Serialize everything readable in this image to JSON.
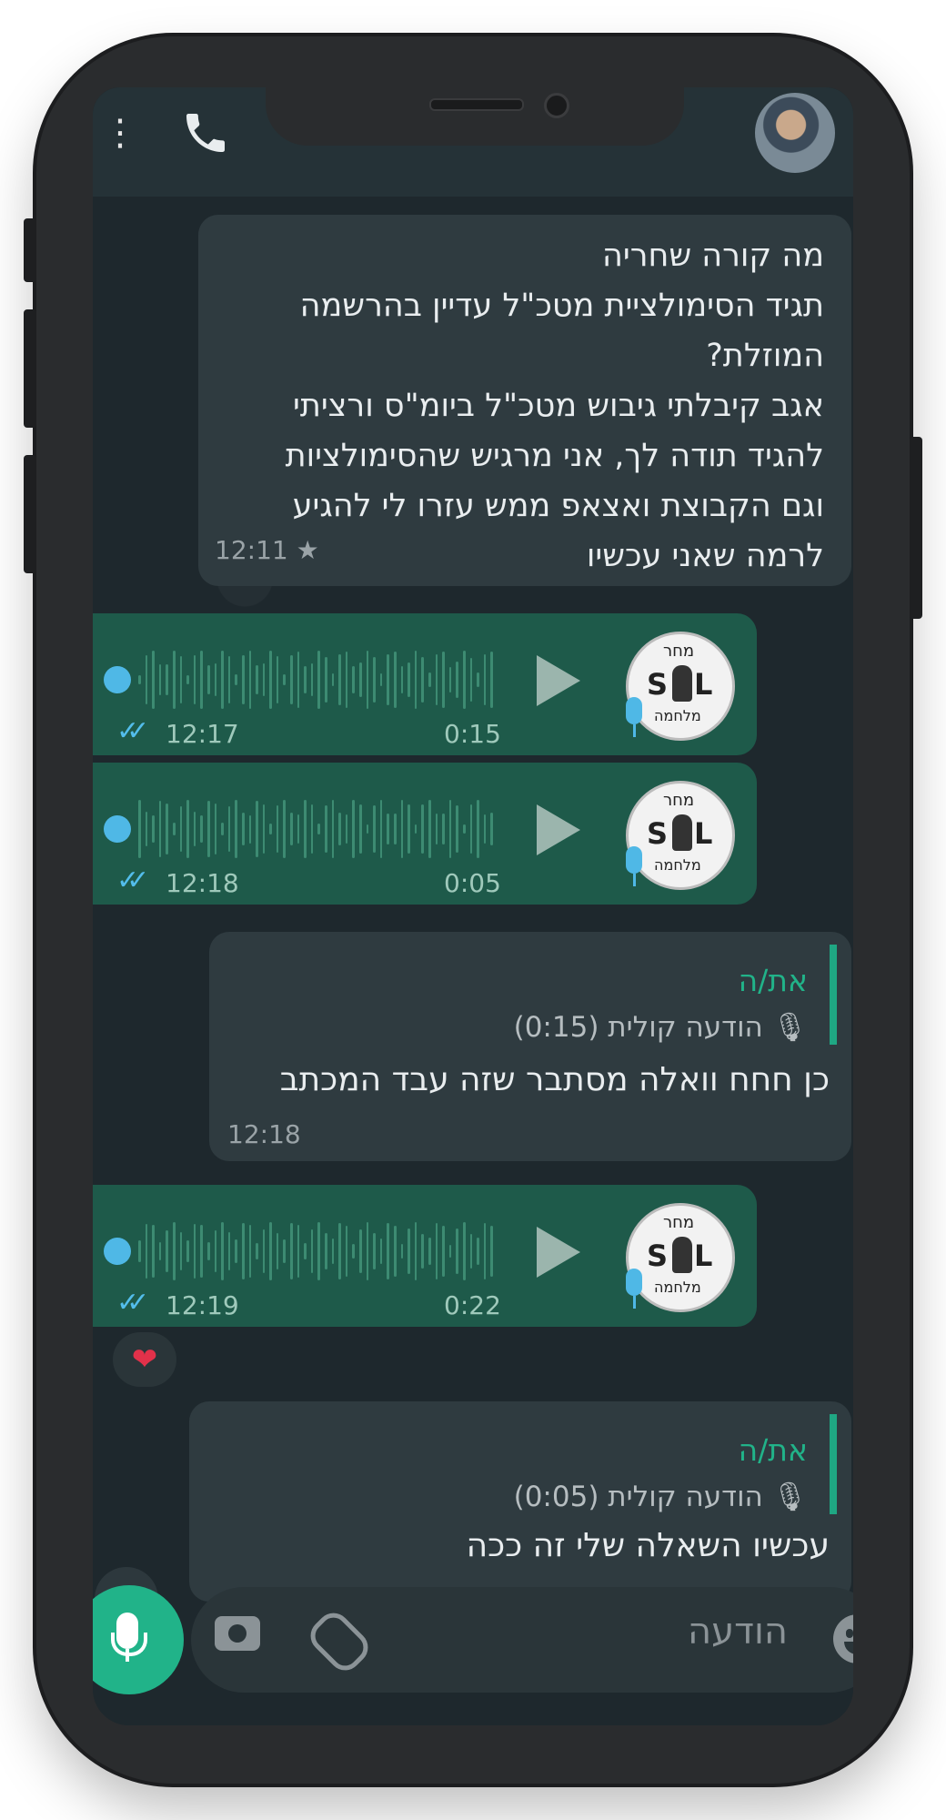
{
  "header": {
    "menu_icon": "more-vert-icon",
    "call_icon": "phone-icon"
  },
  "messages": [
    {
      "type": "text",
      "lines": [
        "מה קורה שחריה",
        "תגיד הסימולציית מטכ\"ל עדיין בהרשמה",
        "המוזלת?",
        "אגב קיבלתי גיבוש מטכ\"ל ביומ\"ס ורציתי",
        "להגיד תודה לך, אני מרגיש שהסימולציות",
        "וגם הקבוצת ואצאפ ממש עזרו לי להגיע",
        "לרמה שאני עכשיו"
      ],
      "time": "12:11",
      "starred": "★"
    },
    {
      "type": "voice",
      "time": "12:17",
      "duration": "0:15",
      "ticks": "✓✓"
    },
    {
      "type": "voice",
      "time": "12:18",
      "duration": "0:05",
      "ticks": "✓✓"
    },
    {
      "type": "reply",
      "quote_name": "את/ה",
      "quote_text": "הודעה קולית (0:15)",
      "text": "כן חחח וואלה מסתבר שזה עבד המכתב",
      "time": "12:18"
    },
    {
      "type": "voice",
      "time": "12:19",
      "duration": "0:22",
      "ticks": "✓✓",
      "reaction": "❤"
    },
    {
      "type": "reply",
      "quote_name": "את/ה",
      "quote_text": "הודעה קולית (0:05)",
      "text": "עכשיו השאלה שלי זה ככה"
    }
  ],
  "logo": {
    "top": "מחר",
    "s": "S",
    "l": "L",
    "bottom": "מלחמה"
  },
  "composer": {
    "placeholder": "הודעה"
  },
  "scroll_down_icon": "⌄",
  "colors": {
    "accent": "#21b389",
    "voice_bubble": "#1e5a4a",
    "incoming_bubble": "#2f3b40",
    "background": "#1e282d"
  }
}
